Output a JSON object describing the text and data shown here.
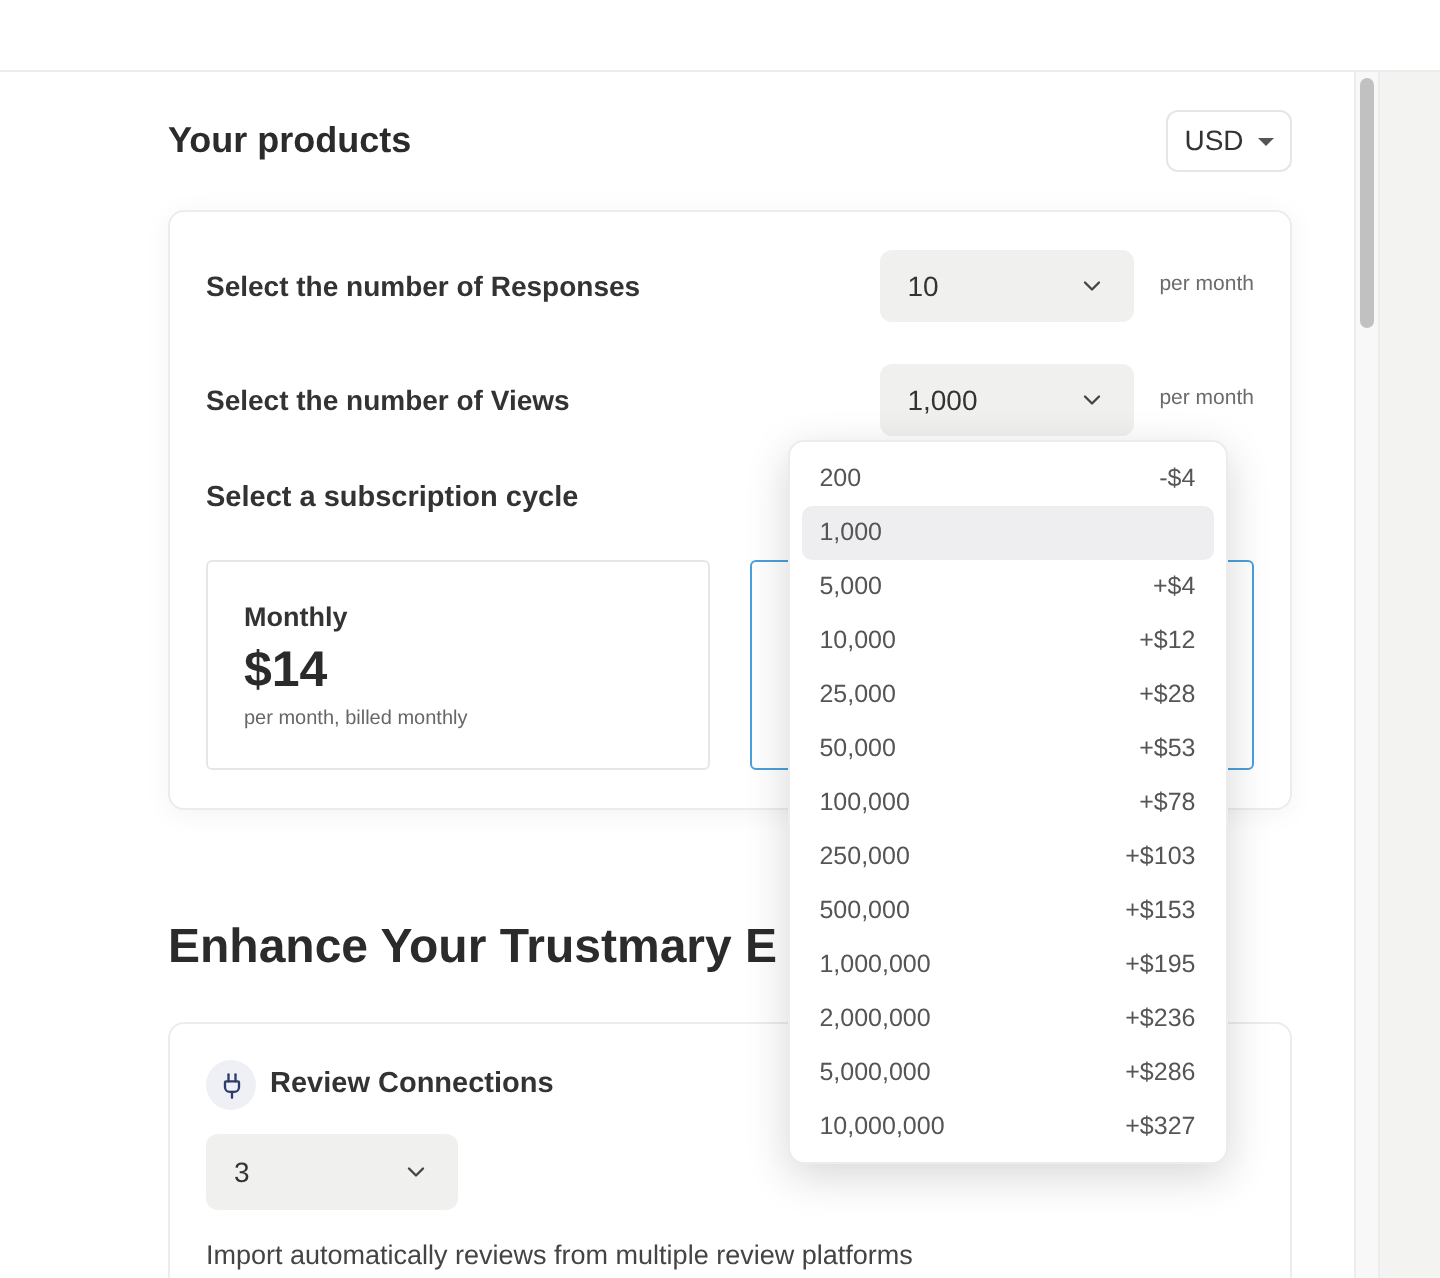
{
  "header": {
    "title": "Your products",
    "currency": "USD"
  },
  "products": {
    "rows": [
      {
        "label": "Select the number of Responses",
        "value": "10",
        "unit": "per month"
      },
      {
        "label": "Select the number of Views",
        "value": "1,000",
        "unit": "per month",
        "dropdown": {
          "options": [
            {
              "label": "200",
              "price": "-$4",
              "selected": false
            },
            {
              "label": "1,000",
              "selected": true
            },
            {
              "label": "5,000",
              "price": "+$4",
              "selected": false
            },
            {
              "label": "10,000",
              "price": "+$12",
              "selected": false
            },
            {
              "label": "25,000",
              "price": "+$28",
              "selected": false
            },
            {
              "label": "50,000",
              "price": "+$53",
              "selected": false
            },
            {
              "label": "100,000",
              "price": "+$78",
              "selected": false
            },
            {
              "label": "250,000",
              "price": "+$103",
              "selected": false
            },
            {
              "label": "500,000",
              "price": "+$153",
              "selected": false
            },
            {
              "label": "1,000,000",
              "price": "+$195",
              "selected": false
            },
            {
              "label": "2,000,000",
              "price": "+$236",
              "selected": false
            },
            {
              "label": "5,000,000",
              "price": "+$286",
              "selected": false
            },
            {
              "label": "10,000,000",
              "price": "+$327",
              "selected": false
            }
          ]
        }
      }
    ],
    "cycle_title": "Select a subscription cycle",
    "cycles": [
      {
        "name": "Monthly",
        "price": "$14",
        "note": "per month, billed monthly",
        "selected": false
      },
      {
        "selected": true
      }
    ]
  },
  "addons": {
    "title": "Enhance Your Trustmary E",
    "items": [
      {
        "title": "Review Connections",
        "value": "3",
        "description": "Import automatically reviews from multiple review platforms"
      }
    ]
  }
}
